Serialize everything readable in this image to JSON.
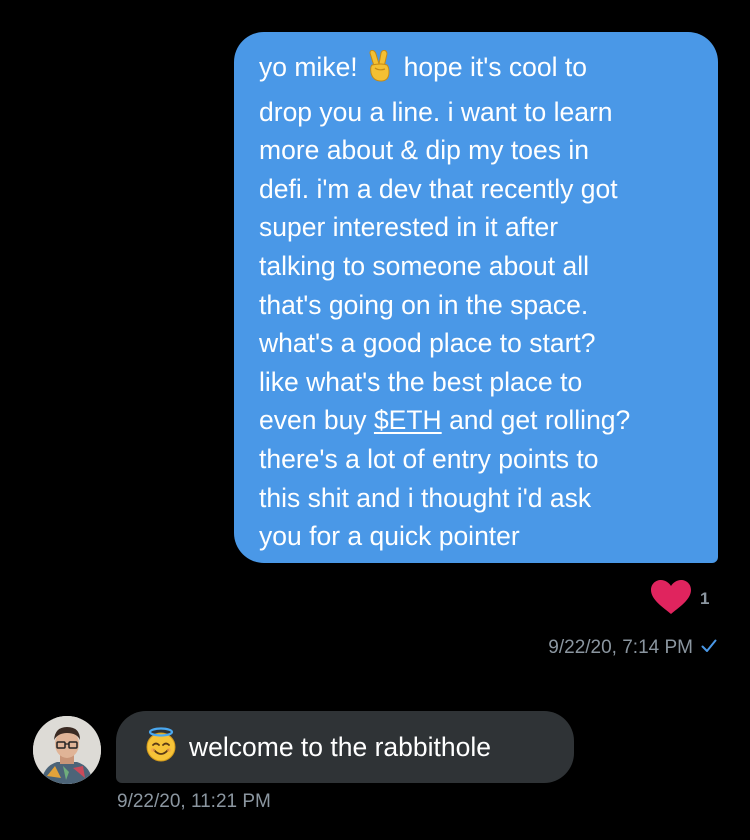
{
  "sent_message": {
    "lines": {
      "l1_before": "yo mike!",
      "l1_after": "hope it's cool to",
      "l2": "drop you a line. i want to learn",
      "l3": "more about & dip my toes in",
      "l4": "defi. i'm a dev that recently got",
      "l5": "super interested in it after",
      "l6": "talking to someone about all",
      "l7": "that's going on in the space.",
      "l8": "what's a good place to start?",
      "l9": "like what's the best place to",
      "l10_before": "even buy",
      "l10_link": "$ETH",
      "l10_after": "and get rolling?",
      "l11": "there's a lot of entry points to",
      "l12": "this shit and i thought i'd ask",
      "l13": "you for a quick pointer"
    },
    "emoji": "victory-hand-emoji",
    "bubble_color": "#4a98e7",
    "reaction": {
      "icon": "heart-icon",
      "count": "1",
      "color": "#e0245e"
    },
    "timestamp": "9/22/20, 7:14 PM",
    "status_icon": "checkmark-icon"
  },
  "received_message": {
    "emoji": "smiling-face-with-halo-emoji",
    "text": "welcome to the rabbithole",
    "bubble_color": "#2f3336",
    "timestamp": "9/22/20, 11:21 PM",
    "avatar": "user-avatar"
  },
  "colors": {
    "background": "#000000",
    "meta_text": "#8b96a0",
    "check": "#4a98e7"
  }
}
